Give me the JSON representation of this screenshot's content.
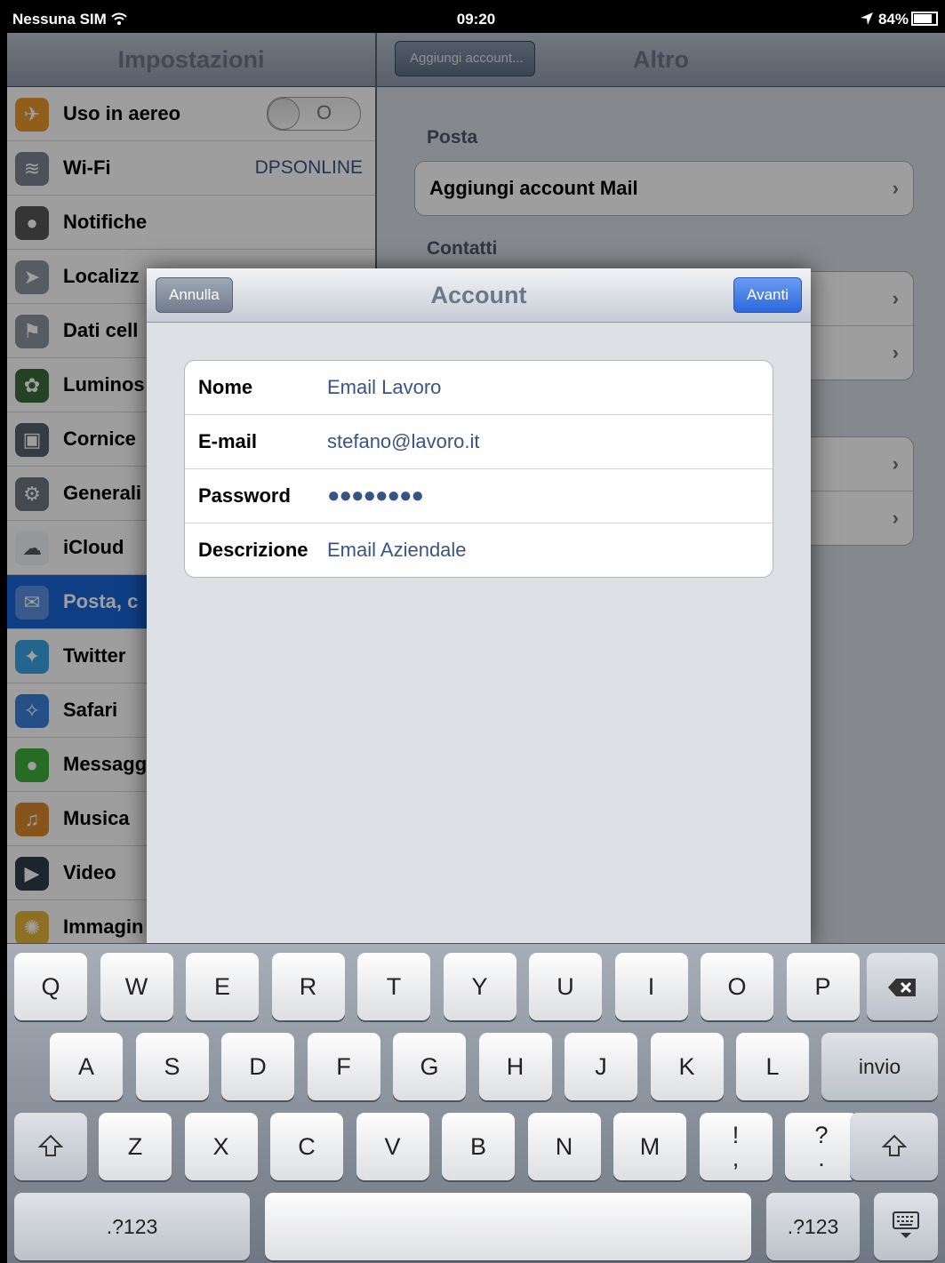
{
  "status_bar": {
    "carrier": "Nessuna SIM",
    "wifi_icon": "wifi-icon",
    "time": "09:20",
    "location_icon": "location-arrow-icon",
    "battery": "84%"
  },
  "settings_pane": {
    "title": "Impostazioni",
    "items": [
      {
        "label": "Uso in aereo",
        "icon": "airplane-icon",
        "toggle": "O"
      },
      {
        "label": "Wi-Fi",
        "icon": "wifi-icon",
        "value": "DPSONLINE"
      },
      {
        "label": "Notifiche",
        "icon": "notifications-icon"
      },
      {
        "label": "Localizz",
        "icon": "location-icon"
      },
      {
        "label": "Dati cell",
        "icon": "cellular-icon"
      },
      {
        "label": "Luminos",
        "icon": "brightness-icon"
      },
      {
        "label": "Cornice",
        "icon": "picture-frame-icon"
      },
      {
        "label": "Generali",
        "icon": "gear-icon"
      },
      {
        "label": "iCloud",
        "icon": "cloud-icon"
      },
      {
        "label": "Posta, c",
        "icon": "mail-icon",
        "selected": true
      },
      {
        "label": "Twitter",
        "icon": "twitter-icon"
      },
      {
        "label": "Safari",
        "icon": "safari-compass-icon"
      },
      {
        "label": "Messagg",
        "icon": "messages-icon"
      },
      {
        "label": "Musica",
        "icon": "music-icon"
      },
      {
        "label": "Video",
        "icon": "video-icon"
      },
      {
        "label": "Immagin",
        "icon": "photos-icon"
      }
    ]
  },
  "detail_pane": {
    "back_label": "Aggiungi account...",
    "title": "Altro",
    "sections": [
      {
        "header": "Posta",
        "rows": [
          "Aggiungi account Mail"
        ]
      },
      {
        "header": "Contatti",
        "rows": [
          "",
          ""
        ]
      },
      {
        "header": "",
        "rows": [
          "",
          ""
        ]
      }
    ]
  },
  "account_modal": {
    "title": "Account",
    "cancel_label": "Annulla",
    "next_label": "Avanti",
    "fields": [
      {
        "label": "Nome",
        "value": "Email Lavoro"
      },
      {
        "label": "E-mail",
        "value": "stefano@lavoro.it"
      },
      {
        "label": "Password",
        "value": "●●●●●●●●"
      },
      {
        "label": "Descrizione",
        "value": "Email Aziendale"
      }
    ]
  },
  "keyboard": {
    "row1": [
      "Q",
      "W",
      "E",
      "R",
      "T",
      "Y",
      "U",
      "I",
      "O",
      "P"
    ],
    "backspace_icon": "backspace-icon",
    "row2": [
      "A",
      "S",
      "D",
      "F",
      "G",
      "H",
      "J",
      "K",
      "L"
    ],
    "return_label": "invio",
    "shift_icon": "shift-icon",
    "row3": [
      "Z",
      "X",
      "C",
      "V",
      "B",
      "N",
      "M"
    ],
    "punct1": [
      "!",
      ","
    ],
    "punct2": [
      "?",
      "."
    ],
    "numbers_label": ".?123",
    "hide_keyboard_icon": "hide-keyboard-icon"
  }
}
